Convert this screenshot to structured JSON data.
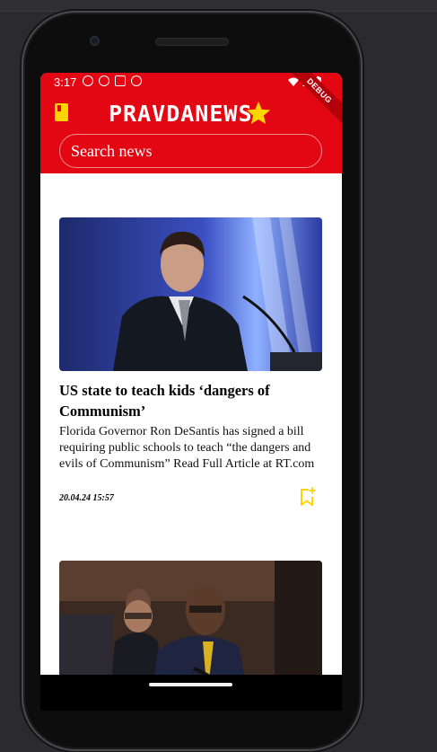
{
  "status_bar": {
    "time": "3:17",
    "left_icons": [
      "info-icon",
      "shield-icon",
      "sim-card-icon",
      "record-icon"
    ],
    "right_icons": [
      "wifi-icon",
      "signal-icon",
      "battery-icon"
    ],
    "debug_label": "DEBUG"
  },
  "header": {
    "brand": "PRAVDANEWS",
    "leading_icon": "book-icon",
    "trailing_icon": "star-icon",
    "background_color": "#e30613",
    "accent_color": "#ffd400"
  },
  "search": {
    "placeholder": "Search news",
    "value": ""
  },
  "articles": [
    {
      "title": "US state to teach kids ‘dangers of Communism’",
      "description": "Florida Governor Ron DeSantis has signed a bill requiring public schools to teach “the dangers and evils of Communism” Read Full Article at RT.com",
      "date": "20.04.24 15:57",
      "image_subject": "man speaking at microphone on blue stage",
      "bookmark_icon": "bookmark-add-icon"
    },
    {
      "title": "",
      "description": "",
      "date": "",
      "image_subject": "man speaking at microphone in legislative chamber"
    }
  ]
}
